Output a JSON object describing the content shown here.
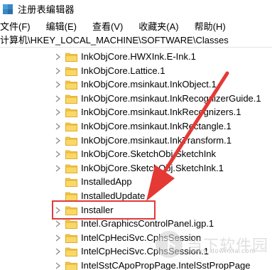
{
  "window": {
    "title": "注册表编辑器"
  },
  "menu": [
    {
      "label": "文件(F)"
    },
    {
      "label": "编辑(E)"
    },
    {
      "label": "查看(V)"
    },
    {
      "label": "收藏夹(A)"
    },
    {
      "label": "帮助(H)"
    }
  ],
  "address": {
    "path": "计算机\\HKEY_LOCAL_MACHINE\\SOFTWARE\\Classes"
  },
  "tree_items": [
    {
      "label": "InkObjCore.HWXInk.E-Ink.1",
      "expandable": true
    },
    {
      "label": "InkObjCore.Lattice.1",
      "expandable": true
    },
    {
      "label": "InkObjCore.msinkaut.InkObject.1",
      "expandable": true
    },
    {
      "label": "InkObjCore.msinkaut.InkRecognizerGuide.1",
      "expandable": true
    },
    {
      "label": "InkObjCore.msinkaut.InkRecognizers.1",
      "expandable": true
    },
    {
      "label": "InkObjCore.msinkaut.InkRectangle.1",
      "expandable": true
    },
    {
      "label": "InkObjCore.msinkaut.InkTransform.1",
      "expandable": true
    },
    {
      "label": "InkObjCore.SketchObj.SketchInk",
      "expandable": true
    },
    {
      "label": "InkObjCore.SketchObj.SketchInk.1",
      "expandable": true
    },
    {
      "label": "InstalledApp",
      "expandable": false
    },
    {
      "label": "InstalledUpdate",
      "expandable": false
    },
    {
      "label": "Installer",
      "expandable": true,
      "highlighted": true
    },
    {
      "label": "Intel.GraphicsControlPanel.igp.1",
      "expandable": true
    },
    {
      "label": "IntelCpHeciSvc.CphsSession",
      "expandable": true
    },
    {
      "label": "IntelCpHeciSvc.CphsSession.1",
      "expandable": true
    },
    {
      "label": "IntelSstCApoPropPage.IntelSstPropPage",
      "expandable": true
    }
  ],
  "annotation": {
    "highlight_color": "#e23a3a",
    "arrow_color": "#e53935"
  },
  "watermark": {
    "logo": "下",
    "text": "当下软件园",
    "url": "www.downxia.com"
  }
}
